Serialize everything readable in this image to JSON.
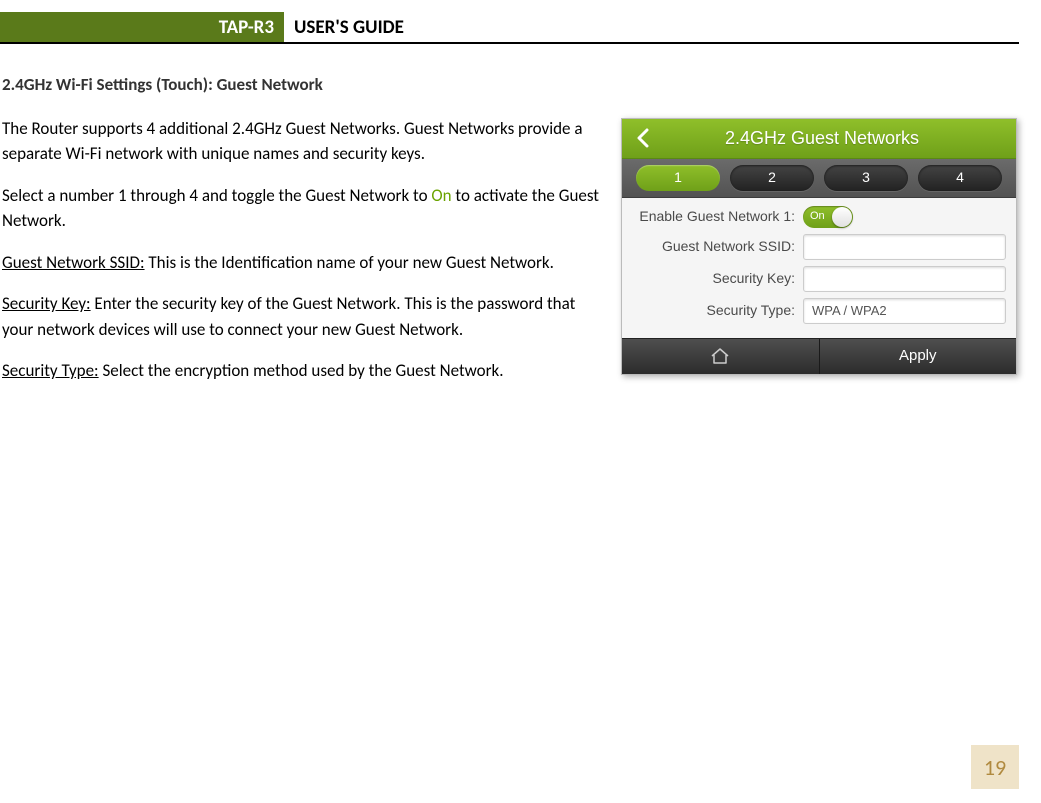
{
  "header": {
    "tag": "TAP-R3",
    "title": "USER'S GUIDE"
  },
  "section_title": "2.4GHz Wi-Fi Settings (Touch): Guest Network",
  "para1": "The Router supports 4 additional 2.4GHz Guest Networks.  Guest Networks provide a separate Wi-Fi network with unique names and security keys.",
  "para2_a": "Select a number 1 through 4 and toggle the Guest Network to ",
  "para2_on": "On",
  "para2_b": " to activate the Guest Network.",
  "ssid_label": "Guest Network SSID:",
  "ssid_desc": " This is the Identification name of your new Guest Network.",
  "seckey_label": "Security Key:",
  "seckey_desc": " Enter the security key of the Guest Network. This is the password that your network devices will use to connect your new Guest Network.",
  "sectype_label": "Security Type:",
  "sectype_desc": " Select the encryption method used by the Guest Network.",
  "page_number": "19",
  "device": {
    "title": "2.4GHz Guest Networks",
    "pills": [
      "1",
      "2",
      "3",
      "4"
    ],
    "enable_label": "Enable Guest Network 1:",
    "toggle_text": "On",
    "ssid_label": "Guest Network SSID:",
    "key_label": "Security Key:",
    "type_label": "Security Type:",
    "type_value": "WPA / WPA2",
    "apply": "Apply"
  }
}
